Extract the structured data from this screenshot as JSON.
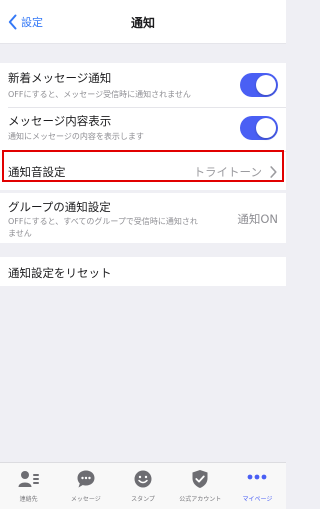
{
  "nav": {
    "back_label": "設定",
    "title": "通知"
  },
  "settings": [
    {
      "title": "新着メッセージ通知",
      "description": "OFFにすると、メッセージ受信時に通知されません",
      "toggle": true
    },
    {
      "title": "メッセージ内容表示",
      "description": "通知にメッセージの内容を表示します",
      "toggle": true
    },
    {
      "title": "通知音設定",
      "value": "トライトーン"
    },
    {
      "title": "グループの通知設定",
      "description_line1": "OFFにすると、すべてのグループで受信時に通知され",
      "description_line2": "ません",
      "value": "通知ON"
    },
    {
      "title": "通知設定をリセット"
    }
  ],
  "tabs": [
    {
      "label": "連絡先",
      "icon": "contacts-icon"
    },
    {
      "label": "メッセージ",
      "icon": "chat-bubble-icon"
    },
    {
      "label": "スタンプ",
      "icon": "smiley-icon"
    },
    {
      "label": "公式アカウント",
      "icon": "shield-check-icon"
    },
    {
      "label": "マイページ",
      "icon": "more-dots-icon",
      "active": true
    }
  ],
  "colors": {
    "accent": "#4a5ff4",
    "link": "#3478f6",
    "highlight": "#e10000"
  }
}
